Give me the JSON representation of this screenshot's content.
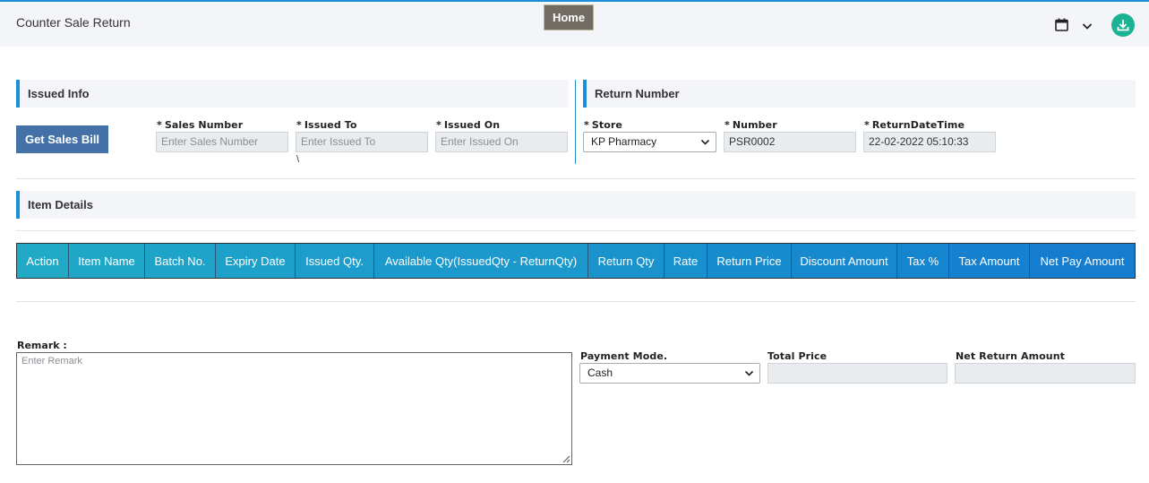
{
  "header": {
    "title": "Counter Sale Return",
    "home_label": "Home",
    "icons": [
      "calendar-icon",
      "chevron-down-icon",
      "download-icon"
    ],
    "accent_color": "#1ab394"
  },
  "issued_info": {
    "title": "Issued Info",
    "get_sales_bill_label": "Get Sales Bill",
    "sales_number": {
      "label": "Sales Number",
      "placeholder": "Enter Sales Number",
      "value": ""
    },
    "issued_to": {
      "label": "Issued To",
      "placeholder": "Enter Issued To",
      "value": ""
    },
    "issued_on": {
      "label": "Issued On",
      "placeholder": "Enter Issued On",
      "value": ""
    },
    "stray_text": "\\"
  },
  "return_number": {
    "title": "Return Number",
    "store": {
      "label": "Store",
      "selected": "KP Pharmacy"
    },
    "number": {
      "label": "Number",
      "value": "PSR0002"
    },
    "return_datetime": {
      "label": "ReturnDateTime",
      "value": "22-02-2022 05:10:33"
    }
  },
  "item_details": {
    "title": "Item Details",
    "columns": [
      "Action",
      "Item Name",
      "Batch No.",
      "Expiry Date",
      "Issued Qty.",
      "Available Qty(IssuedQty - ReturnQty)",
      "Return Qty",
      "Rate",
      "Return Price",
      "Discount Amount",
      "Tax %",
      "Tax Amount",
      "Net Pay Amount"
    ]
  },
  "footer": {
    "remark_label": "Remark :",
    "remark_placeholder": "Enter Remark",
    "payment_mode": {
      "label": "Payment Mode.",
      "selected": "Cash"
    },
    "total_price": {
      "label": "Total Price",
      "value": ""
    },
    "net_return_amount": {
      "label": "Net Return Amount",
      "value": ""
    }
  },
  "required_marker": "*"
}
